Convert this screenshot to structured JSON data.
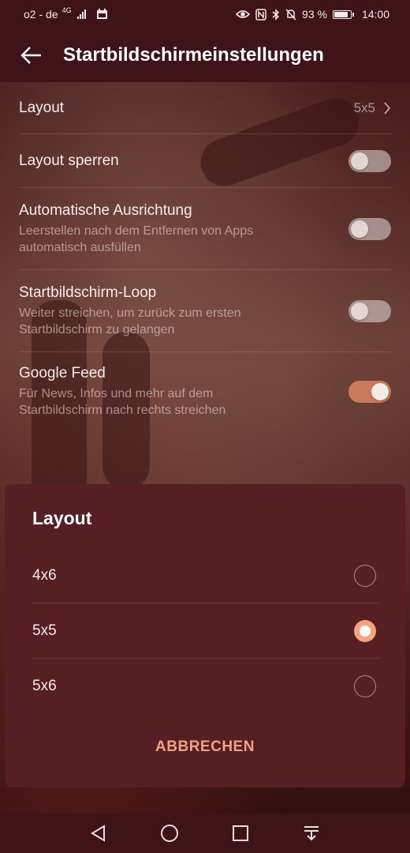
{
  "status": {
    "carrier": "o2 - de",
    "network": "4G",
    "battery": "93 %",
    "time": "14:00"
  },
  "header": {
    "title": "Startbildschirmeinstellungen"
  },
  "settings": {
    "layout": {
      "title": "Layout",
      "value": "5x5"
    },
    "lock": {
      "title": "Layout sperren",
      "enabled": false
    },
    "auto_align": {
      "title": "Automatische Ausrichtung",
      "subtitle_line1": "Leerstellen nach dem Entfernen von Apps",
      "subtitle_line2": "automatisch ausfüllen",
      "enabled": false
    },
    "loop": {
      "title": "Startbildschirm-Loop",
      "subtitle_line1": "Weiter streichen, um zurück zum ersten",
      "subtitle_line2": "Startbildschirm zu gelangen",
      "enabled": false
    },
    "google_feed": {
      "title": "Google Feed",
      "subtitle_line1": "Für News, Infos und mehr auf dem",
      "subtitle_line2": "Startbildschirm nach rechts streichen",
      "enabled": true
    }
  },
  "dialog": {
    "title": "Layout",
    "options": [
      {
        "label": "4x6",
        "selected": false
      },
      {
        "label": "5x5",
        "selected": true
      },
      {
        "label": "5x6",
        "selected": false
      }
    ],
    "cancel_label": "ABBRECHEN"
  },
  "colors": {
    "accent": "#f2a184",
    "toggle_on": "#c97a5c",
    "dialog_bg": "#561f24",
    "bar_bg": "#3e1418"
  },
  "icons": {
    "back": "arrow-left-icon",
    "nav_back": "triangle-back-icon",
    "nav_home": "circle-home-icon",
    "nav_recent": "square-recent-icon",
    "nav_notifications": "pull-down-icon"
  }
}
